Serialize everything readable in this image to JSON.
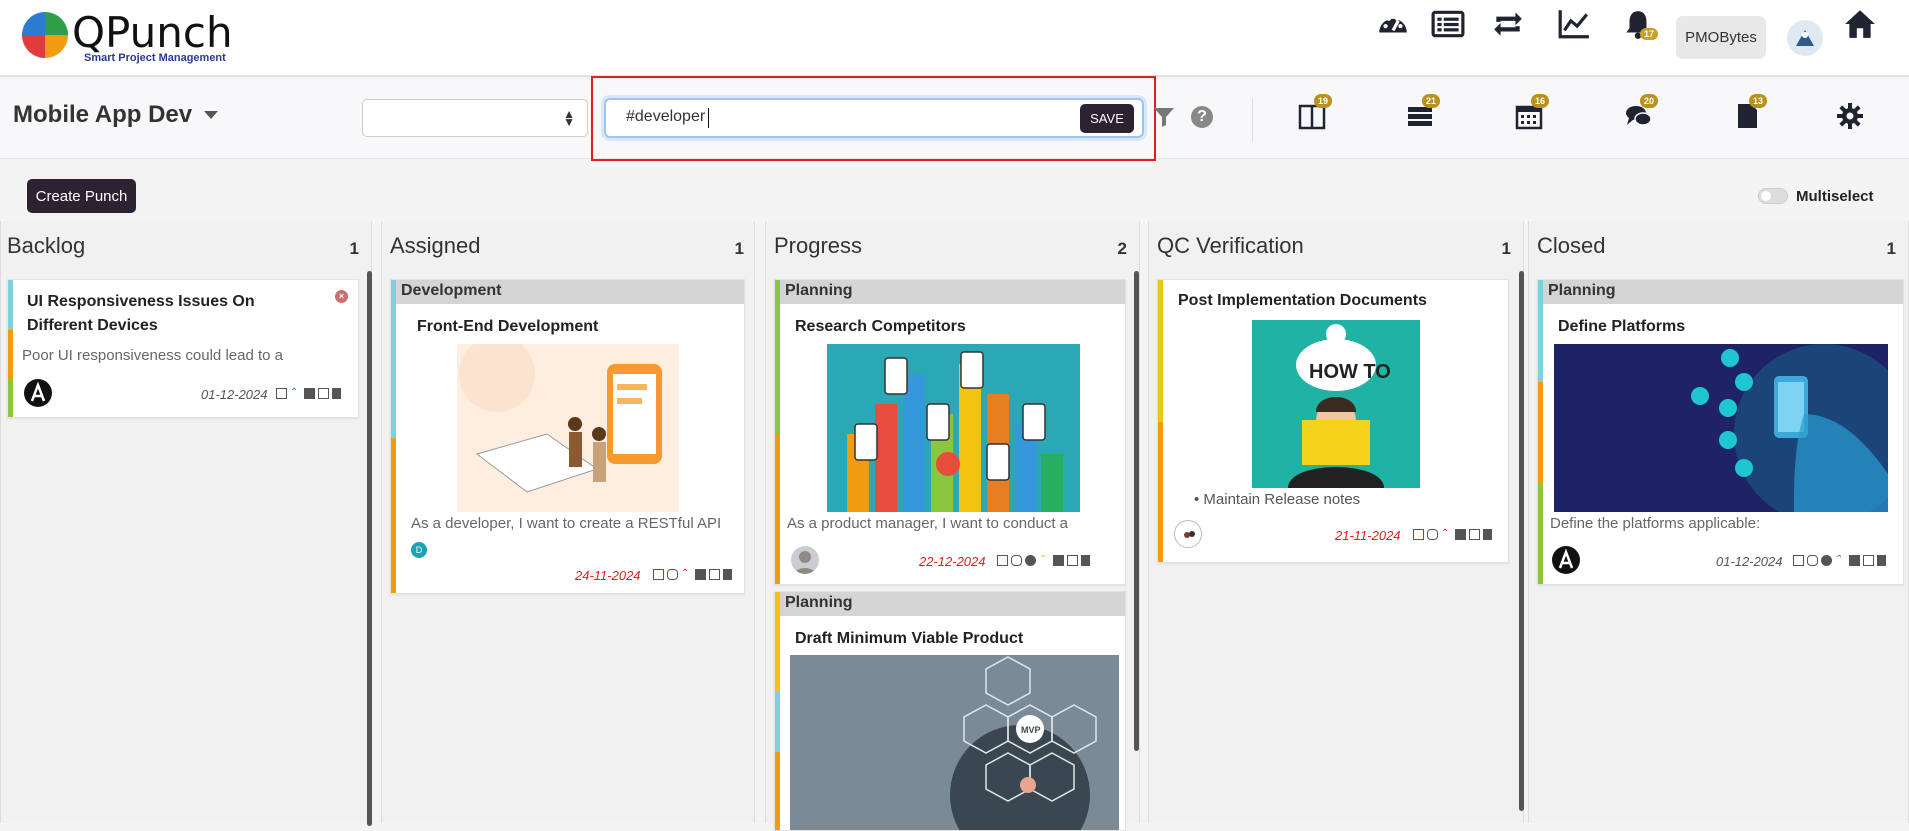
{
  "brand": {
    "name": "QPunch",
    "tagline": "Smart Project Management"
  },
  "topnav": {
    "notification_count": "17",
    "user_label": "PMOBytes"
  },
  "project": {
    "title": "Mobile App Dev"
  },
  "search": {
    "value": "#developer",
    "save_label": "SAVE"
  },
  "view_icons": [
    {
      "name": "board",
      "badge": "19"
    },
    {
      "name": "list",
      "badge": "21"
    },
    {
      "name": "calendar",
      "badge": "16"
    },
    {
      "name": "chat",
      "badge": "20"
    },
    {
      "name": "document",
      "badge": "13"
    }
  ],
  "actions": {
    "create_label": "Create Punch",
    "multiselect_label": "Multiselect"
  },
  "columns": [
    {
      "title": "Backlog",
      "count": "1"
    },
    {
      "title": "Assigned",
      "count": "1"
    },
    {
      "title": "Progress",
      "count": "2"
    },
    {
      "title": "QC Verification",
      "count": "1"
    },
    {
      "title": "Closed",
      "count": "1"
    }
  ],
  "cards": {
    "backlog_1": {
      "title_line1": "UI Responsiveness Issues On",
      "title_line2": "Different Devices",
      "desc": "Poor UI responsiveness could lead to a",
      "date": "01-12-2024"
    },
    "assigned_1": {
      "category": "Development",
      "title": "Front-End Development",
      "desc": "As a developer, I want to create a RESTful API",
      "avatar_initial": "D",
      "date": "24-11-2024"
    },
    "progress_1": {
      "category": "Planning",
      "title": "Research Competitors",
      "desc": "As a product manager, I want to conduct a",
      "date": "22-12-2024"
    },
    "progress_2": {
      "category": "Planning",
      "title": "Draft Minimum Viable Product",
      "image_text": "MVP"
    },
    "qc_1": {
      "title": "Post Implementation Documents",
      "image_text": "HOW TO",
      "bullet": "Maintain Release notes",
      "date": "21-11-2024"
    },
    "closed_1": {
      "category": "Planning",
      "title": "Define Platforms",
      "desc": "Define the platforms applicable:",
      "date": "01-12-2024"
    }
  }
}
